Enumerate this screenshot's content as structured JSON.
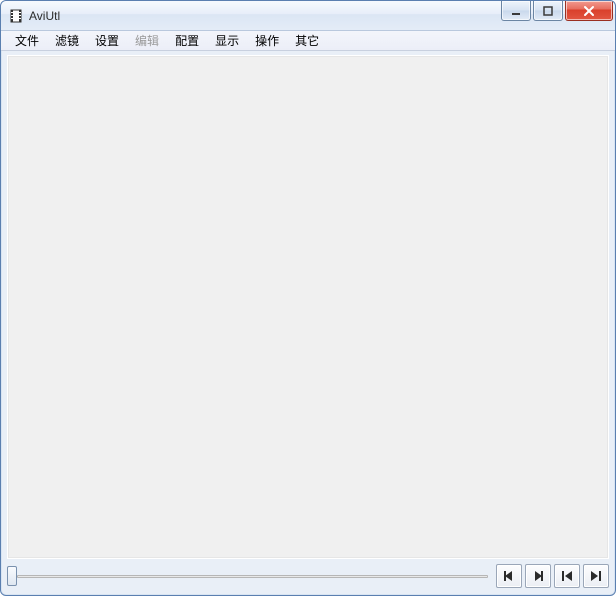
{
  "window": {
    "title": "AviUtl"
  },
  "menu": {
    "items": [
      {
        "label": "文件",
        "disabled": false
      },
      {
        "label": "滤镜",
        "disabled": false
      },
      {
        "label": "设置",
        "disabled": false
      },
      {
        "label": "编辑",
        "disabled": true
      },
      {
        "label": "配置",
        "disabled": false
      },
      {
        "label": "显示",
        "disabled": false
      },
      {
        "label": "操作",
        "disabled": false
      },
      {
        "label": "其它",
        "disabled": false
      }
    ]
  },
  "icons": {
    "app": "film-icon",
    "minimize": "minimize-icon",
    "maximize": "maximize-icon",
    "close": "close-icon",
    "prev_frame": "prev-frame-icon",
    "next_frame": "next-frame-icon",
    "to_start": "to-start-icon",
    "to_end": "to-end-icon"
  }
}
